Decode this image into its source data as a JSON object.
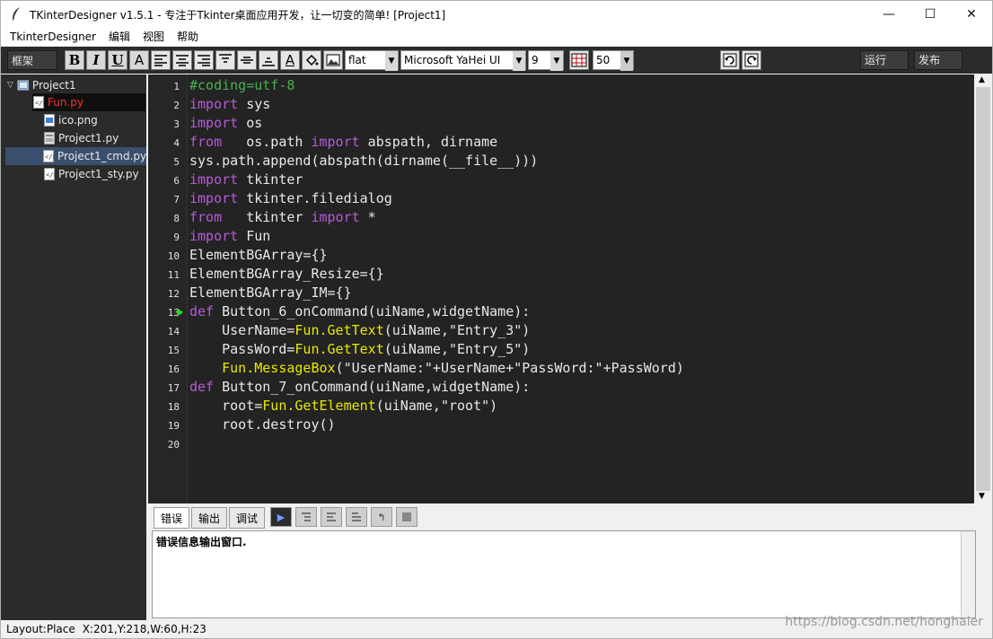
{
  "window": {
    "title": "TKinterDesigner v1.5.1 - 专注于Tkinter桌面应用开发，让一切变的简单!   [Project1]",
    "minimize": "—",
    "maximize": "☐",
    "close": "✕"
  },
  "menubar": {
    "items": [
      "TkinterDesigner",
      "编辑",
      "视图",
      "帮助"
    ]
  },
  "toolbar": {
    "frame_combo": "框架",
    "bold": "B",
    "italic": "I",
    "underline": "U",
    "fontcolor": "A",
    "relief_value": "flat",
    "font_value": "Microsoft YaHei UI",
    "size_value": "9",
    "grid_value": "50",
    "run_button": "运行",
    "publish_button": "发布"
  },
  "tree": {
    "root": "Project1",
    "files": [
      {
        "name": "Fun.py",
        "state": "active-red"
      },
      {
        "name": "ico.png",
        "state": "normal"
      },
      {
        "name": "Project1.py",
        "state": "normal"
      },
      {
        "name": "Project1_cmd.py",
        "state": "selected"
      },
      {
        "name": "Project1_sty.py",
        "state": "normal"
      }
    ]
  },
  "editor": {
    "line_numbers": [
      "1",
      "2",
      "3",
      "4",
      "5",
      "6",
      "7",
      "8",
      "9",
      "10",
      "11",
      "12",
      "13",
      "14",
      "15",
      "16",
      "17",
      "18",
      "19",
      "20"
    ],
    "breakpoint_line": 13
  },
  "output": {
    "tabs": [
      "错误",
      "输出",
      "调试"
    ],
    "active_tab": "错误",
    "message": "错误信息输出窗口."
  },
  "statusbar": {
    "layout": "Layout:Place",
    "coords": "X:201,Y:218,W:60,H:23"
  },
  "watermark": "https://blog.csdn.net/honghaier"
}
